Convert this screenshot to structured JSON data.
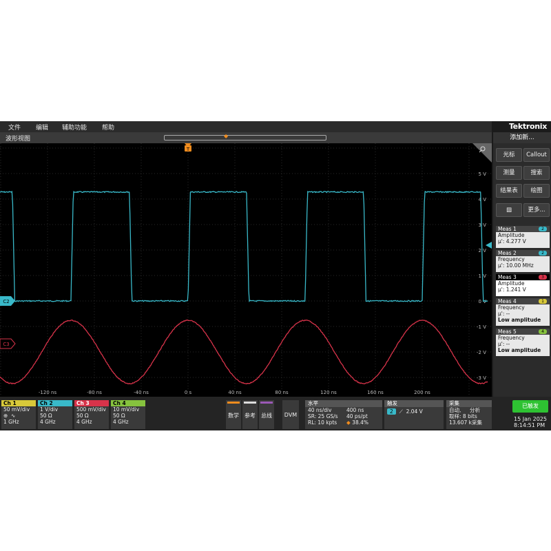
{
  "menu": {
    "file": "文件",
    "edit": "编辑",
    "utility": "辅助功能",
    "help": "帮助"
  },
  "brand": "Tektronix",
  "waveform_view": {
    "title": "波形视图"
  },
  "colors": {
    "ch1": "#d8c93a",
    "ch2": "#39b9c9",
    "ch3": "#d8334a",
    "ch4": "#86c23e",
    "trigger_marker": "#f08c1e",
    "done": "#2ec232"
  },
  "icons": {
    "zoom": "magnifier-icon",
    "trigger": "trigger-marker-icon"
  },
  "plot": {
    "time_unit": "ns",
    "time_ticks": [
      "-120 ns",
      "-80 ns",
      "-40 ns",
      "0 s",
      "40 ns",
      "80 ns",
      "120 ns",
      "160 ns",
      "200 ns"
    ],
    "time_values": [
      -120,
      -80,
      -40,
      0,
      40,
      80,
      120,
      160,
      200
    ],
    "volt_ticks": [
      "5 V",
      "4 V",
      "3 V",
      "2 V",
      "1 V",
      "0 V",
      "-1 V",
      "-2 V",
      "-3 V"
    ],
    "ch2_label": "C2",
    "ch3_label": "C3",
    "trigger_label": "T"
  },
  "waves": {
    "square": {
      "low_v": 0.0,
      "high_v": 4.277,
      "period_ns": 100
    },
    "sine": {
      "center_v": -2.0,
      "amplitude_v": 1.241,
      "period_ns": 100
    }
  },
  "right_panel": {
    "add_new": "添加新...",
    "buttons": {
      "cursor": "光标",
      "callout": "Callout",
      "measure": "测量",
      "search": "搜索",
      "results": "结果表",
      "plot": "绘图",
      "more": "更多..."
    },
    "measurements": [
      {
        "name": "Meas 1",
        "type": "Amplitude",
        "value": "µ': 4.277 V",
        "badge": "2"
      },
      {
        "name": "Meas 2",
        "type": "Frequency",
        "value": "µ': 10.00 MHz",
        "badge": "2"
      },
      {
        "name": "Meas 3",
        "type": "Amplitude",
        "value": "µ': 1.241 V",
        "badge": "3"
      },
      {
        "name": "Meas 4",
        "type": "Frequency",
        "value": "µ': --",
        "status": "Low amplitude",
        "badge": "1"
      },
      {
        "name": "Meas 5",
        "type": "Frequency",
        "value": "µ': --",
        "status": "Low amplitude",
        "badge": "4"
      }
    ]
  },
  "channels": [
    {
      "name": "Ch 1",
      "scale": "50 mV/div",
      "imp": "",
      "bw": "1 GHz"
    },
    {
      "name": "Ch 2",
      "scale": "1 V/div",
      "imp": "50 Ω",
      "bw": "4 GHz"
    },
    {
      "name": "Ch 3",
      "scale": "500 mV/div",
      "imp": "50 Ω",
      "bw": "4 GHz"
    },
    {
      "name": "Ch 4",
      "scale": "10 mV/div",
      "imp": "50 Ω",
      "bw": "4 GHz"
    }
  ],
  "bottom_buttons": {
    "math": "数学",
    "ref": "参考",
    "bus": "总线",
    "dvm": "DVM"
  },
  "horizontal": {
    "title": "水平",
    "scale": "40 ns/div",
    "position": "400 ns",
    "sr": "SR: 25 GS/s",
    "rate": "40 ps/pt",
    "rl": "RL: 10 kpts",
    "pct": "38.4%"
  },
  "trigger": {
    "title": "触发",
    "source": "2",
    "level": "2.04 V"
  },
  "acquire": {
    "title": "采集",
    "mode": "自动,",
    "analyze": "分析",
    "bits": "取样: 8 bits",
    "count": "13.607 k采集"
  },
  "status": {
    "done": "已触发",
    "date": "15 Jan 2025",
    "time": "8:14:51 PM"
  }
}
